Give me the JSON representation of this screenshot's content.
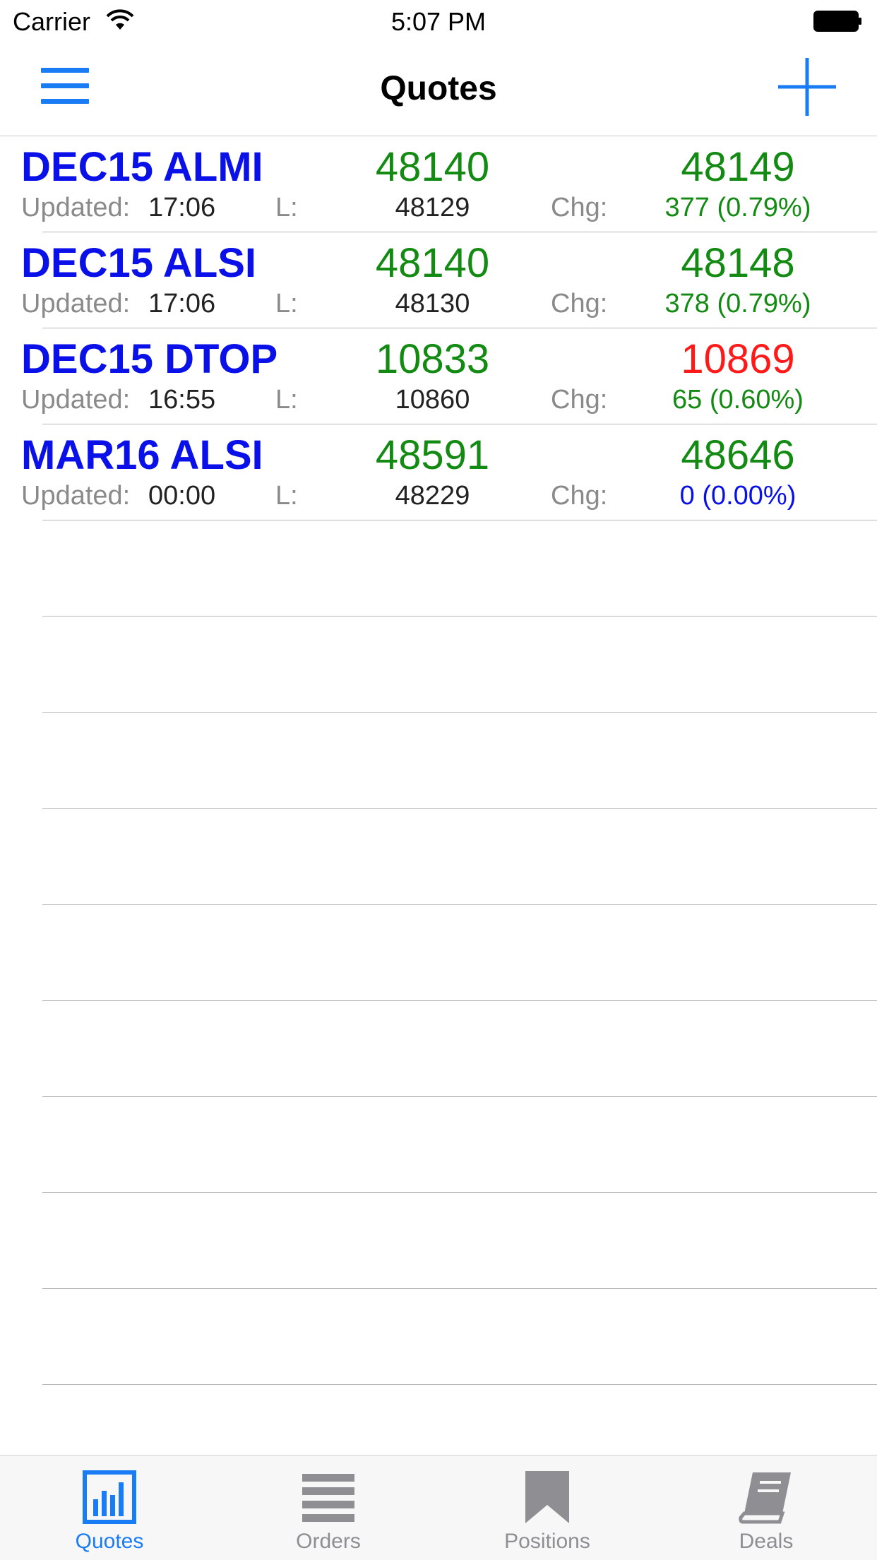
{
  "status_bar": {
    "carrier": "Carrier",
    "time": "5:07 PM"
  },
  "nav": {
    "title": "Quotes"
  },
  "quotes": [
    {
      "symbol": "DEC15 ALMI",
      "bid": "48140",
      "ask": "48149",
      "updated_label": "Updated:",
      "updated": "17:06",
      "last_label": "L:",
      "last": "48129",
      "chg_label": "Chg:",
      "change": "377  (0.79%)"
    },
    {
      "symbol": "DEC15 ALSI",
      "bid": "48140",
      "ask": "48148",
      "updated_label": "Updated:",
      "updated": "17:06",
      "last_label": "L:",
      "last": "48130",
      "chg_label": "Chg:",
      "change": "378  (0.79%)"
    },
    {
      "symbol": "DEC15 DTOP",
      "bid": "10833",
      "ask": "10869",
      "updated_label": "Updated:",
      "updated": "16:55",
      "last_label": "L:",
      "last": "10860",
      "chg_label": "Chg:",
      "change": "65  (0.60%)"
    },
    {
      "symbol": "MAR16 ALSI",
      "bid": "48591",
      "ask": "48646",
      "updated_label": "Updated:",
      "updated": "00:00",
      "last_label": "L:",
      "last": "48229",
      "chg_label": "Chg:",
      "change": "0  (0.00%)"
    }
  ],
  "tabs": [
    {
      "label": "Quotes",
      "icon": "bar-chart-icon",
      "active": true
    },
    {
      "label": "Orders",
      "icon": "list-icon",
      "active": false
    },
    {
      "label": "Positions",
      "icon": "bookmark-icon",
      "active": false
    },
    {
      "label": "Deals",
      "icon": "book-icon",
      "active": false
    }
  ],
  "colors": {
    "accent": "#1a7cf5",
    "symbol": "#0a10e8",
    "up": "#138a12",
    "down": "#ff1a1a",
    "unchanged": "#0a10e8"
  }
}
